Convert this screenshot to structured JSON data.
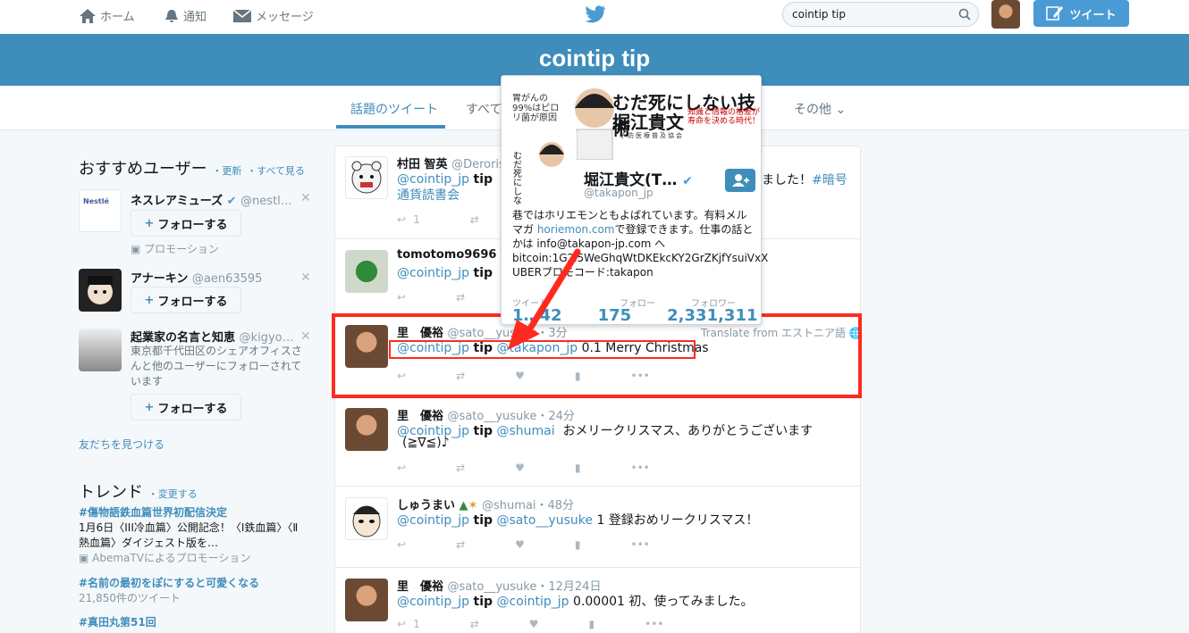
{
  "nav": {
    "home": "ホーム",
    "notifications": "通知",
    "messages": "メッセージ",
    "search_value": "cointip tip",
    "tweet_button": "ツイート"
  },
  "banner": {
    "title": "cointip tip"
  },
  "tabs": {
    "top": "話題のツイート",
    "all": "すべて",
    "more": "その他"
  },
  "sidebar": {
    "heading": "おすすめユーザー",
    "refresh": "・更新",
    "view_all": "・すべて見る",
    "follow_label": "フォローする",
    "users": [
      {
        "name": "ネスレアミューズ",
        "handle": "@nestl…",
        "note": "プロモーション"
      },
      {
        "name": "アナーキン",
        "handle": "@aen63595"
      },
      {
        "name": "起業家の名言と知恵",
        "handle": "@kigyo…",
        "note": "東京都千代田区のシェアオフィスさんと他のユーザーにフォローされています"
      }
    ],
    "find_friends": "友だちを見つける",
    "trends_heading": "トレンド",
    "trends_change": "・変更する",
    "trends": [
      {
        "tag": "#傷物語鉄血篇世界初配信決定",
        "desc": "1月6日〈III冷血篇〉公開記念！〈Ⅰ鉄血篇〉〈Ⅱ熱血篇〉ダイジェスト版を…",
        "note": "AbemaTVによるプロモーション"
      },
      {
        "tag": "#名前の最初をぽにすると可愛くなる",
        "desc": "21,850件のツイート"
      },
      {
        "tag": "#真田丸第51回"
      }
    ]
  },
  "tweets": [
    {
      "name": "村田 智英",
      "handle": "@Deroris",
      "m1": "@cointip_jp",
      "w1": "tip",
      "rest": "",
      "suffix": "ました！",
      "tag": "#暗号",
      "line2": "通貨読書会",
      "replies": "1"
    },
    {
      "name": "tomotomo9696",
      "handle": "@",
      "m1": "@cointip_jp",
      "w1": "tip",
      "rest": ""
    },
    {
      "name": "里　優裕",
      "handle": "@sato__yusuke",
      "time": "・3分",
      "m1": "@cointip_jp",
      "w1": "tip",
      "m2": "@takapon_jp",
      "rest": "0.1 Merry Christmas",
      "translate": "Translate from エストニア語"
    },
    {
      "name": "里　優裕",
      "handle": "@sato__yusuke",
      "time": "・24分",
      "m1": "@cointip_jp",
      "w1": "tip",
      "m2": "@shumai",
      "rest": "おメリークリスマス、ありがとうございます",
      "line2": "(≧∇≦)♪"
    },
    {
      "name": "しゅうまい",
      "handle": "@shumai",
      "time": "・48分",
      "m1": "@cointip_jp",
      "w1": "tip",
      "m2": "@sato__yusuke",
      "rest": "1 登録おめリークリスマス！"
    },
    {
      "name": "里　優裕",
      "handle": "@sato__yusuke",
      "time": "・12月24日",
      "m1": "@cointip_jp",
      "w1": "tip",
      "m2": "@cointip_jp",
      "rest": "0.00001 初、使ってみました。",
      "replies": "1"
    }
  ],
  "card": {
    "banner_title1": "むだ死にしない技術",
    "banner_title2": "堀江貴文",
    "banner_sub": "知識と情報の格差が寿命を決める時代！",
    "banner_left": "胃がんの99%はピロリ菌が原因",
    "banner_org": "予防医療普及協会",
    "name": "堀江貴文(T…",
    "handle": "@takapon_jp",
    "bio1": "巷ではホリエモンともよばれています。有料メルマガ ",
    "bio_link": "horiemon.com",
    "bio2": "で登録できます。仕事の話とかは info@takapon-jp.com へ bitcoin:1G2i5WeGhqWtDKEkcKY2GrZKjfYsuiVxX UBERプロモコード:takapon",
    "stat_tweets": "ツイート",
    "stat_following": "フォロー",
    "stat_followers": "フォロワー",
    "num_tweets": "1…42",
    "num_following": "175",
    "num_followers": "2,331,311"
  }
}
